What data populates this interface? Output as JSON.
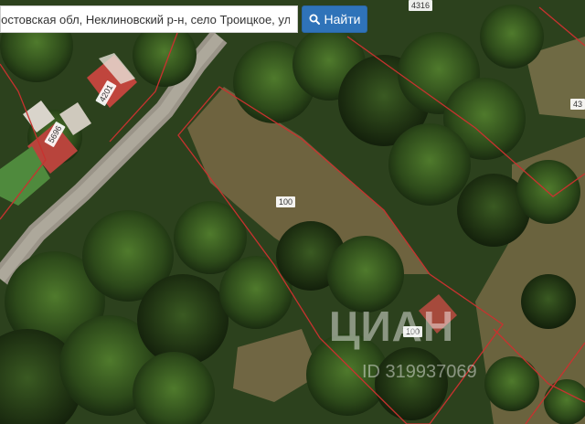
{
  "search": {
    "value": "Ростовская обл, Неклиновский р-н, село Троицкое, ул Кавк",
    "button_label": "Найти"
  },
  "parcels": {
    "main_label_1": "100",
    "main_label_2": "100",
    "top_label": "4316",
    "right_label": "43",
    "house_label_1": "4201",
    "house_label_2": "5696"
  },
  "watermark": {
    "brand": "ЦИАН",
    "id": "ID 319937069"
  },
  "colors": {
    "parcel_border": "#c8322f",
    "button": "#2f73b9"
  }
}
